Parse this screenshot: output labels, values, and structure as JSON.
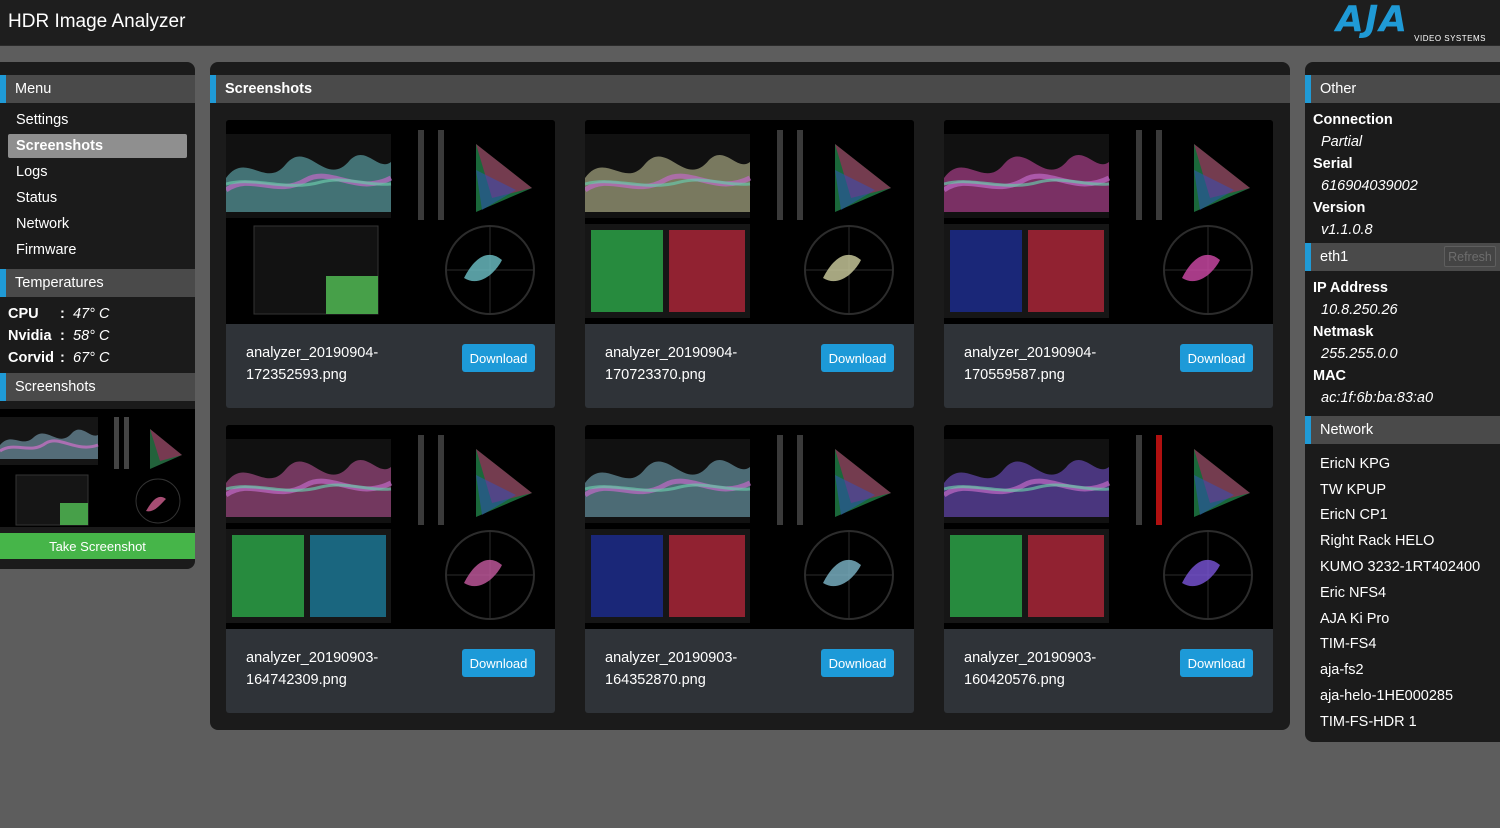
{
  "app": {
    "title": "HDR Image Analyzer"
  },
  "logo": {
    "text": "AJA",
    "subtitle": "VIDEO SYSTEMS"
  },
  "left": {
    "menu_header": "Menu",
    "menu_items": [
      {
        "label": "Settings"
      },
      {
        "label": "Screenshots"
      },
      {
        "label": "Logs"
      },
      {
        "label": "Status"
      },
      {
        "label": "Network"
      },
      {
        "label": "Firmware"
      }
    ],
    "temperatures_header": "Temperatures",
    "temperatures": [
      {
        "name": "CPU",
        "colon": ":",
        "value": "47° C"
      },
      {
        "name": "Nvidia",
        "colon": ":",
        "value": "58° C"
      },
      {
        "name": "Corvid",
        "colon": ":",
        "value": "67° C"
      }
    ],
    "screenshots_header": "Screenshots",
    "take_screenshot_label": "Take Screenshot"
  },
  "center": {
    "header": "Screenshots",
    "download_label": "Download",
    "cards": [
      {
        "name_line1": "analyzer_20190904-",
        "name_line2": "172352593.png",
        "accent": "#6ec3c9"
      },
      {
        "name_line1": "analyzer_20190904-",
        "name_line2": "170723370.png",
        "accent": "#d0d0a0"
      },
      {
        "name_line1": "analyzer_20190904-",
        "name_line2": "170559587.png",
        "accent": "#d14aa9"
      },
      {
        "name_line1": "analyzer_20190903-",
        "name_line2": "164742309.png",
        "accent": "#c55aa0"
      },
      {
        "name_line1": "analyzer_20190903-",
        "name_line2": "164352870.png",
        "accent": "#7db6c9"
      },
      {
        "name_line1": "analyzer_20190903-",
        "name_line2": "160420576.png",
        "accent": "#7a55d9"
      }
    ]
  },
  "right": {
    "other_header": "Other",
    "connection_label": "Connection",
    "connection_value": "Partial",
    "serial_label": "Serial",
    "serial_value": "616904039002",
    "version_label": "Version",
    "version_value": "v1.1.0.8",
    "eth_header": "eth1",
    "refresh_label": "Refresh",
    "ip_label": "IP Address",
    "ip_value": "10.8.250.26",
    "netmask_label": "Netmask",
    "netmask_value": "255.255.0.0",
    "mac_label": "MAC",
    "mac_value": "ac:1f:6b:ba:83:a0",
    "network_header": "Network",
    "network_items": [
      "EricN KPG",
      "TW KPUP",
      "EricN CP1",
      "Right Rack HELO",
      "KUMO 3232-1RT402400",
      "Eric NFS4",
      "AJA Ki Pro",
      "TIM-FS4",
      "aja-fs2",
      "aja-helo-1HE000285",
      "TIM-FS-HDR 1"
    ]
  },
  "colors": {
    "accent_blue": "#1f9ad6",
    "download_blue": "#1d9ad8",
    "take_screenshot_green": "#46b549",
    "active_menu": "#8f8f8f"
  }
}
